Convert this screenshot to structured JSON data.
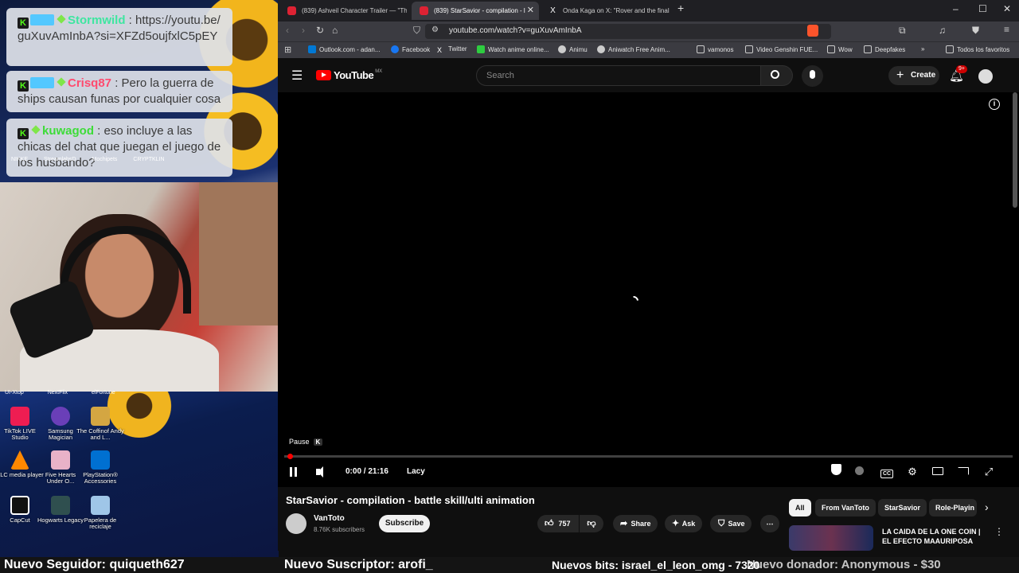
{
  "overlay": {
    "chat": [
      {
        "user": "Stormwild",
        "user_color": "#3ee6a0",
        "message": "https://youtu.be/guXuvAmInbA?si=XFZd5oujfxlC5pEY"
      },
      {
        "user": "Crisq87",
        "user_color": "#ff4a6e",
        "message": "Pero la guerra de ships causan funas por cualquier cosa"
      },
      {
        "user": "kuwagod",
        "user_color": "#3ddc38",
        "message": "eso incluye a las chicas del chat que juegan el juego de los husbando?"
      }
    ],
    "behind_chat_labels": [
      "NIKKE",
      "StreamlabsD",
      "Mochipets",
      "CRYPTKLIN"
    ],
    "desktop_icons": [
      {
        "label": "TikTok LIVE Studio",
        "color": "#ee1d52"
      },
      {
        "label": "Samsung Magician",
        "color": "#6a3fb8"
      },
      {
        "label": "The Coffinof Andy and L...",
        "color": "#d4a642"
      },
      {
        "label": "VLC media player",
        "color": "#ff8800"
      },
      {
        "label": "Five Hearts Under O...",
        "color": "#e9b2c8"
      },
      {
        "label": "PlayStation® Accessories",
        "color": "#0070d1"
      },
      {
        "label": "CapCut",
        "color": "#ffffff"
      },
      {
        "label": "Hogwarts Legacy",
        "color": "#2f4f4f"
      },
      {
        "label": "Papelera de reciclaje",
        "color": "#9fc6e8"
      }
    ],
    "desktop_top_labels": [
      "UI-Xtop",
      "NextFlix",
      "elFortune"
    ]
  },
  "browser": {
    "tabs": [
      {
        "label": "(839) Ashveil Character Trailer — \"Th",
        "fav": "#d23"
      },
      {
        "label": "(839) StarSavior - compilation - l",
        "fav": "#d23"
      },
      {
        "label": "Onda Kaga on X: \"Rover and the final",
        "fav": "#ddd"
      }
    ],
    "new_tab": "+",
    "url": "youtube.com/watch?v=guXuvAmInbA",
    "bookmarks": [
      {
        "label": "Outlook.com - adan...",
        "color": "#0078d4"
      },
      {
        "label": "Facebook",
        "color": "#1877f2"
      },
      {
        "label": "Twitter",
        "color": "#ffffff"
      },
      {
        "label": "Watch anime online...",
        "color": "#2ecc40"
      },
      {
        "label": "Animu",
        "color": "#cccccc"
      },
      {
        "label": "Aniwatch Free Anim...",
        "color": "#cccccc"
      },
      {
        "label": "vamonos",
        "color": "#cccccc"
      },
      {
        "label": "Video Genshin FUE...",
        "color": "#cccccc"
      },
      {
        "label": "Wow",
        "color": "#cccccc"
      },
      {
        "label": "Deepfakes",
        "color": "#cccccc"
      },
      {
        "label": "Todos los favoritos",
        "color": "#cccccc"
      }
    ]
  },
  "youtube": {
    "logo": "YouTube",
    "region": "MX",
    "search_placeholder": "Search",
    "create_label": "Create",
    "notif_count": "9+",
    "player": {
      "tooltip": "Pause",
      "tooltip_key": "K",
      "time": "0:00 / 21:16",
      "chapter": "Lacy",
      "progress": 0.0
    },
    "video_title": "StarSavior - compilation - battle skill/ulti animation",
    "channel": "VanToto",
    "subscribers": "8.76K subscribers",
    "subscribe_label": "Subscribe",
    "likes": "757",
    "share_label": "Share",
    "ask_label": "Ask",
    "save_label": "Save",
    "chips": [
      "All",
      "From VanToto",
      "StarSavior",
      "Role-Playin"
    ],
    "reco_title": "LA CAIDA DE LA ONE COIN | EL EFECTO MAAURIPOSA"
  },
  "ticker": {
    "follower": "Nuevo Seguidor: quiqueth627",
    "subscriber": "Nuevo Suscriptor: arofi_",
    "bits": "Nuevos bits: israel_el_leon_omg - 7320",
    "donation": "Nuevo donador: Anonymous - $30"
  },
  "colors": {
    "accent": "#ff0000",
    "kick": "#53fc18"
  }
}
